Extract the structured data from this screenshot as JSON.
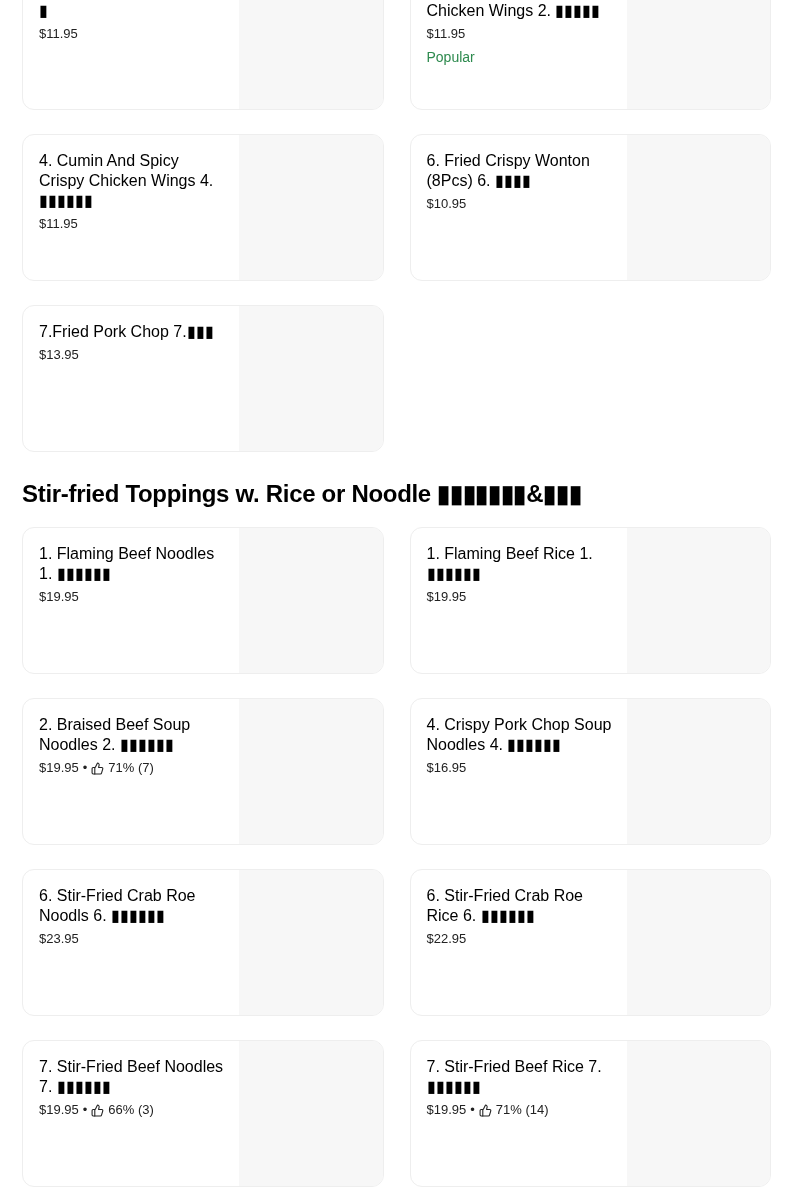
{
  "sections": [
    {
      "items": [
        {
          "name": "▮",
          "price": "$11.95"
        },
        {
          "name": "Chicken Wings 2. ▮▮▮▮▮",
          "price": "$11.95",
          "badge": "Popular"
        },
        {
          "name": "4. Cumin And Spicy Crispy Chicken Wings 4. ▮▮▮▮▮▮",
          "price": "$11.95"
        },
        {
          "name": "6. Fried Crispy Wonton (8Pcs) 6. ▮▮▮▮",
          "price": "$10.95"
        },
        {
          "name": "7.Fried Pork Chop 7.▮▮▮",
          "price": "$13.95"
        }
      ]
    },
    {
      "title": "Stir-fried Toppings w. Rice or Noodle ▮▮▮▮▮▮▮&▮▮▮",
      "items": [
        {
          "name": "1. Flaming Beef Noodles 1. ▮▮▮▮▮▮",
          "price": "$19.95"
        },
        {
          "name": "1. Flaming Beef Rice 1. ▮▮▮▮▮▮",
          "price": "$19.95"
        },
        {
          "name": "2. Braised Beef Soup Noodles 2. ▮▮▮▮▮▮",
          "price": "$19.95",
          "separator": "•",
          "rating": "71% (7)"
        },
        {
          "name": "4. Crispy Pork Chop Soup Noodles 4. ▮▮▮▮▮▮",
          "price": "$16.95"
        },
        {
          "name": "6. Stir-Fried Crab Roe Noodls 6. ▮▮▮▮▮▮",
          "price": "$23.95"
        },
        {
          "name": "6. Stir-Fried Crab Roe Rice 6. ▮▮▮▮▮▮",
          "price": "$22.95"
        },
        {
          "name": "7. Stir-Fried Beef Noodles 7. ▮▮▮▮▮▮",
          "price": "$19.95",
          "separator": "•",
          "rating": "66% (3)"
        },
        {
          "name": "7. Stir-Fried Beef Rice 7. ▮▮▮▮▮▮",
          "price": "$19.95",
          "separator": "•",
          "rating": "71% (14)"
        }
      ]
    }
  ]
}
